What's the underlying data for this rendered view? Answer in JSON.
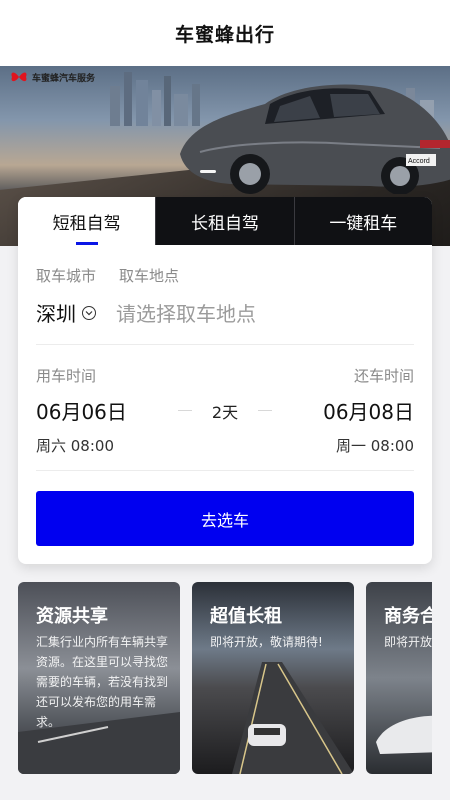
{
  "header": {
    "title": "车蜜蜂出行"
  },
  "banner": {
    "logo_text": "车蜜蜂汽车服务",
    "car_badge": "Accord"
  },
  "tabs": [
    {
      "label": "短租自驾",
      "active": true
    },
    {
      "label": "长租自驾",
      "active": false
    },
    {
      "label": "一键租车",
      "active": false
    }
  ],
  "pickup": {
    "city_label": "取车城市",
    "place_label": "取车地点",
    "city": "深圳",
    "place_placeholder": "请选择取车地点"
  },
  "rental_time": {
    "start_label": "用车时间",
    "end_label": "还车时间",
    "start_date": "06月06日",
    "end_date": "06月08日",
    "duration": "2天",
    "start_day": "周六 08:00",
    "end_day": "周一 08:00"
  },
  "submit_label": "去选车",
  "cards": [
    {
      "title": "资源共享",
      "desc": "汇集行业内所有车辆共享资源。在这里可以寻找您需要的车辆，若没有找到还可以发布您的用车需求。"
    },
    {
      "title": "超值长租",
      "desc": "即将开放，敬请期待!"
    },
    {
      "title": "商务合",
      "desc": "即将开放"
    }
  ],
  "colors": {
    "accent": "#0000f0",
    "tab_dark": "#101114",
    "tab_indicator": "#0a16e6"
  }
}
